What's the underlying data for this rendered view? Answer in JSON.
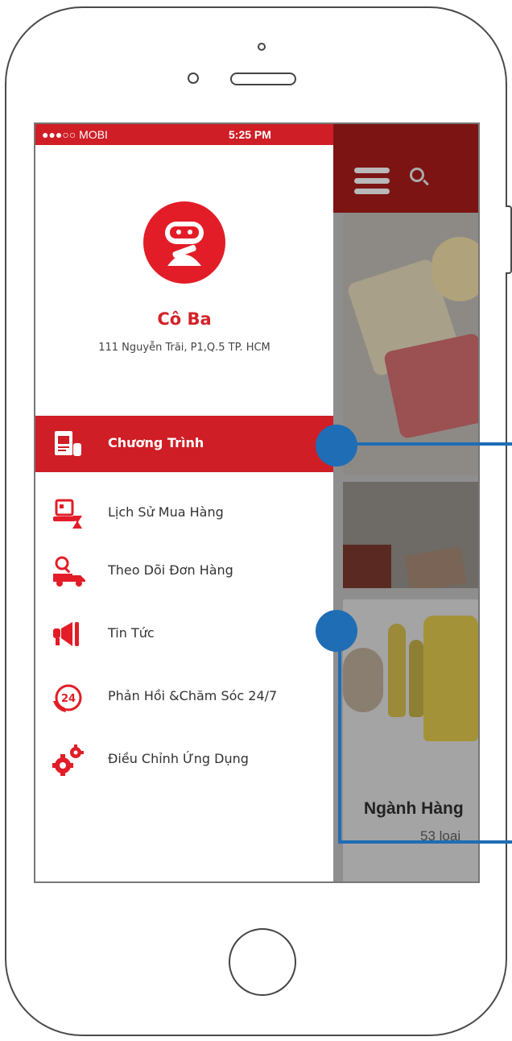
{
  "status_bar": {
    "carrier": "●●●○○ MOBI",
    "time": "5:25 PM"
  },
  "profile": {
    "name": "Cô Ba",
    "address": "111 Nguyễn Trãi, P1,Q.5 TP. HCM"
  },
  "menu": {
    "items": [
      {
        "label": "Chương Trình",
        "icon": "promotion-icon",
        "active": true
      },
      {
        "label": "Lịch Sử Mua Hàng",
        "icon": "purchase-history-icon",
        "active": false
      },
      {
        "label": "Theo Dõi Đơn Hàng",
        "icon": "delivery-truck-icon",
        "active": false
      },
      {
        "label": "Tin Tức",
        "icon": "megaphone-icon",
        "active": false
      },
      {
        "label": "Phản Hồi &Chăm Sóc 24/7",
        "icon": "support-24-icon",
        "active": false
      },
      {
        "label": "Điều Chỉnh Ứng Dụng",
        "icon": "settings-gears-icon",
        "active": false
      }
    ]
  },
  "background_app": {
    "category_title": "Ngành Hàng",
    "category_count": "53 loại"
  },
  "colors": {
    "brand_red": "#cf1e26",
    "callout_blue": "#1f6db5"
  }
}
